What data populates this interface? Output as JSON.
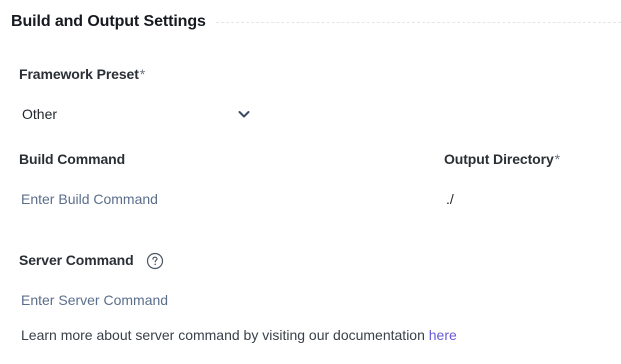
{
  "section": {
    "title": "Build and Output Settings"
  },
  "framework": {
    "label": "Framework Preset",
    "required_mark": "*",
    "selected": "Other"
  },
  "build": {
    "label": "Build Command",
    "placeholder": "Enter Build Command"
  },
  "output": {
    "label": "Output Directory",
    "required_mark": "*",
    "value": "./"
  },
  "server": {
    "label": "Server Command",
    "placeholder": "Enter Server Command"
  },
  "note": {
    "text": "Learn more about server command by visiting our documentation ",
    "link_text": "here"
  },
  "icons": {
    "select": "chevron-down-icon",
    "help": "question-circle-icon"
  },
  "colors": {
    "link": "#6a5bd8",
    "placeholder": "#5b6e8c"
  }
}
